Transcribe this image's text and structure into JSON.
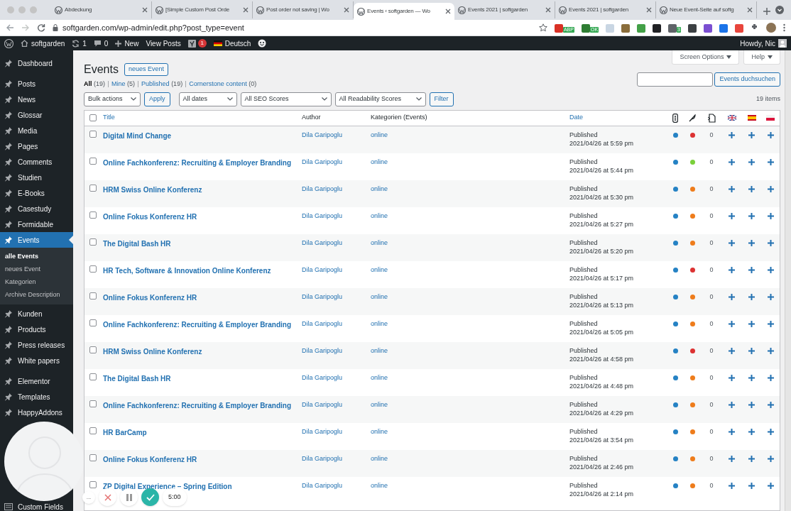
{
  "browser": {
    "tabs": [
      {
        "title": "Abdeckung",
        "selected": false
      },
      {
        "title": "[Simple Custom Post Orde",
        "selected": false
      },
      {
        "title": "Post order not saving | Wo",
        "selected": false
      },
      {
        "title": "Events ‹ softgarden — Wo",
        "selected": true
      },
      {
        "title": "Events 2021 | softgarden",
        "selected": false
      },
      {
        "title": "Events 2021 | softgarden",
        "selected": false
      },
      {
        "title": "Neue Event-Seite auf softg",
        "selected": false
      }
    ],
    "address": "softgarden.com/wp-admin/edit.php?post_type=event",
    "extensions": [
      {
        "color": "#d93025",
        "badge": "ABP"
      },
      {
        "color": "#2e7d32",
        "badge": "OK"
      },
      {
        "color": "#c9d6e3"
      },
      {
        "color": "#8a6d3b"
      },
      {
        "color": "#43a047"
      },
      {
        "color": "#202124"
      },
      {
        "color": "#5f6368",
        "badge": "3"
      },
      {
        "color": "#3c4043"
      },
      {
        "color": "#7b4fd1"
      },
      {
        "color": "#1a73e8"
      },
      {
        "color": "#e8453c"
      }
    ]
  },
  "admin_bar": {
    "site": "softgarden",
    "updates": "1",
    "comments": "0",
    "new": "New",
    "view": "View Posts",
    "yoast_badge": "1",
    "language": "Deutsch",
    "greeting": "Howdy, Nic"
  },
  "sidebar": {
    "items": [
      {
        "label": "Dashboard",
        "selected": false
      },
      {
        "label": "Posts",
        "selected": false
      },
      {
        "label": "News",
        "selected": false
      },
      {
        "label": "Glossar",
        "selected": false
      },
      {
        "label": "Media",
        "selected": false
      },
      {
        "label": "Pages",
        "selected": false
      },
      {
        "label": "Comments",
        "selected": false
      },
      {
        "label": "Studien",
        "selected": false
      },
      {
        "label": "E-Books",
        "selected": false
      },
      {
        "label": "Casestudy",
        "selected": false
      },
      {
        "label": "Formidable",
        "selected": false
      },
      {
        "label": "Events",
        "selected": true,
        "children": [
          {
            "label": "alle Events",
            "selected": true
          },
          {
            "label": "neues Event",
            "selected": false
          },
          {
            "label": "Kategorien",
            "selected": false
          },
          {
            "label": "Archive Description",
            "selected": false
          }
        ]
      },
      {
        "label": "Kunden",
        "selected": false
      },
      {
        "label": "Products",
        "selected": false
      },
      {
        "label": "Press releases",
        "selected": false
      },
      {
        "label": "White papers",
        "selected": false
      },
      {
        "label": "Elementor",
        "selected": false
      },
      {
        "label": "Templates",
        "selected": false
      },
      {
        "label": "HappyAddons",
        "selected": false
      }
    ],
    "bottom_item": "Custom Fields"
  },
  "screen_options": "Screen Options",
  "help": "Help",
  "heading": "Events",
  "add_button": "neues Event",
  "views": [
    {
      "label": "All",
      "count": "(19)",
      "selected": true
    },
    {
      "label": "Mine",
      "count": "(5)",
      "selected": false
    },
    {
      "label": "Published",
      "count": "(19)",
      "selected": false
    },
    {
      "label": "Cornerstone content",
      "count": "(0)",
      "selected": false
    }
  ],
  "search_button": "Events duchsuchen",
  "filters": {
    "bulk": "Bulk actions",
    "apply": "Apply",
    "dates": "All dates",
    "seo": "All SEO Scores",
    "readability": "All Readability Scores",
    "filter": "Filter"
  },
  "item_count": "19 items",
  "table": {
    "select_all_checked": false,
    "columns": {
      "title": "Title",
      "author": "Author",
      "category": "Kategorien (Events)",
      "date": "Date"
    },
    "rows": [
      {
        "title": "Digital Mind Change",
        "author": "Dila Garipoglu",
        "category": "online",
        "checked": false,
        "status": "Published",
        "date": "2021/04/26 at 5:59 pm",
        "seo": {
          "color": "#2582c4"
        },
        "readability": {
          "color": "#dc3232"
        },
        "links": "0"
      },
      {
        "title": "Online Fachkonferenz: Recruiting & Employer Branding",
        "author": "Dila Garipoglu",
        "category": "online",
        "checked": false,
        "status": "Published",
        "date": "2021/04/26 at 5:44 pm",
        "seo": {
          "color": "#2582c4"
        },
        "readability": {
          "color": "#7ad03a"
        },
        "links": "0"
      },
      {
        "title": "HRM Swiss Online Konferenz",
        "author": "Dila Garipoglu",
        "category": "online",
        "checked": false,
        "status": "Published",
        "date": "2021/04/26 at 5:30 pm",
        "seo": {
          "color": "#2582c4"
        },
        "readability": {
          "color": "#ee7c1b"
        },
        "links": "0"
      },
      {
        "title": "Online Fokus Konferenz HR",
        "author": "Dila Garipoglu",
        "category": "online",
        "checked": false,
        "status": "Published",
        "date": "2021/04/26 at 5:27 pm",
        "seo": {
          "color": "#2582c4"
        },
        "readability": {
          "color": "#ee7c1b"
        },
        "links": "0"
      },
      {
        "title": "The Digital Bash HR",
        "author": "Dila Garipoglu",
        "category": "online",
        "checked": false,
        "status": "Published",
        "date": "2021/04/26 at 5:20 pm",
        "seo": {
          "color": "#2582c4"
        },
        "readability": {
          "color": "#ee7c1b"
        },
        "links": "0"
      },
      {
        "title": "HR Tech, Software & Innovation Online Konferenz",
        "author": "Dila Garipoglu",
        "category": "online",
        "checked": false,
        "status": "Published",
        "date": "2021/04/26 at 5:17 pm",
        "seo": {
          "color": "#2582c4"
        },
        "readability": {
          "color": "#dc3232"
        },
        "links": "0"
      },
      {
        "title": "Online Fokus Konferenz HR",
        "author": "Dila Garipoglu",
        "category": "online",
        "checked": false,
        "status": "Published",
        "date": "2021/04/26 at 5:13 pm",
        "seo": {
          "color": "#2582c4"
        },
        "readability": {
          "color": "#ee7c1b"
        },
        "links": "0"
      },
      {
        "title": "Online Fachkonferenz: Recruiting & Employer Branding",
        "author": "Dila Garipoglu",
        "category": "online",
        "checked": false,
        "status": "Published",
        "date": "2021/04/26 at 5:05 pm",
        "seo": {
          "color": "#2582c4"
        },
        "readability": {
          "color": "#ee7c1b"
        },
        "links": "0"
      },
      {
        "title": "HRM Swiss Online Konferenz",
        "author": "Dila Garipoglu",
        "category": "online",
        "checked": false,
        "status": "Published",
        "date": "2021/04/26 at 4:58 pm",
        "seo": {
          "color": "#2582c4"
        },
        "readability": {
          "color": "#dc3232"
        },
        "links": "0"
      },
      {
        "title": "The Digital Bash HR",
        "author": "Dila Garipoglu",
        "category": "online",
        "checked": false,
        "status": "Published",
        "date": "2021/04/26 at 4:48 pm",
        "seo": {
          "color": "#2582c4"
        },
        "readability": {
          "color": "#ee7c1b"
        },
        "links": "0"
      },
      {
        "title": "Online Fachkonferenz: Recruiting & Employer Branding",
        "author": "Dila Garipoglu",
        "category": "online",
        "checked": false,
        "status": "Published",
        "date": "2021/04/26 at 4:29 pm",
        "seo": {
          "color": "#2582c4"
        },
        "readability": {
          "color": "#ee7c1b"
        },
        "links": "0"
      },
      {
        "title": "HR BarCamp",
        "author": "Dila Garipoglu",
        "category": "online",
        "checked": false,
        "status": "Published",
        "date": "2021/04/26 at 3:54 pm",
        "seo": {
          "color": "#2582c4"
        },
        "readability": {
          "color": "#ee7c1b"
        },
        "links": "0"
      },
      {
        "title": "Online Fokus Konferenz HR",
        "author": "Dila Garipoglu",
        "category": "online",
        "checked": false,
        "status": "Published",
        "date": "2021/04/26 at 2:46 pm",
        "seo": {
          "color": "#2582c4"
        },
        "readability": {
          "color": "#ee7c1b"
        },
        "links": "0"
      },
      {
        "title": "ZP Digital Experience – Spring Edition",
        "author": "Dila Garipoglu",
        "category": "online",
        "checked": false,
        "status": "Published",
        "date": "2021/04/26 at 2:14 pm",
        "seo": {
          "color": "#2582c4"
        },
        "readability": {
          "color": "#ee7c1b"
        },
        "links": "0"
      }
    ]
  },
  "recorder": {
    "more": "...",
    "timer": "5:00"
  }
}
